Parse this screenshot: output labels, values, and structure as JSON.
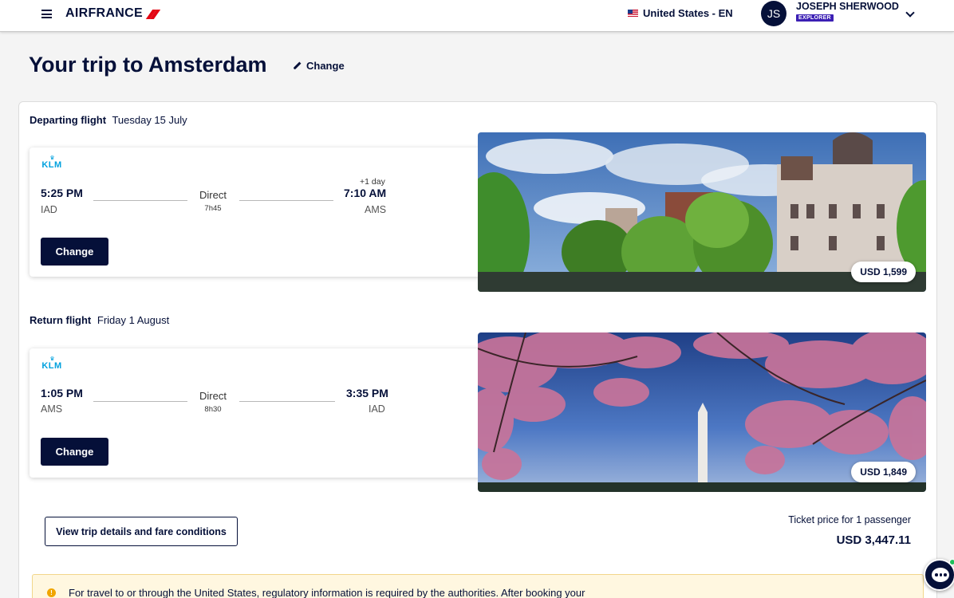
{
  "header": {
    "brand": "AIRFRANCE",
    "locale": "United States - EN",
    "user_initials": "JS",
    "user_name": "JOSEPH SHERWOOD",
    "user_tier": "EXPLORER"
  },
  "page": {
    "title": "Your trip to Amsterdam",
    "change_label": "Change"
  },
  "departing": {
    "label": "Departing flight",
    "date": "Tuesday 15 July",
    "airline": "KLM",
    "dep_time": "5:25 PM",
    "dep_code": "IAD",
    "stops": "Direct",
    "duration": "7h45",
    "day_offset": "+1 day",
    "arr_time": "7:10 AM",
    "arr_code": "AMS",
    "change_label": "Change",
    "price": "USD 1,599"
  },
  "returning": {
    "label": "Return flight",
    "date": "Friday 1 August",
    "airline": "KLM",
    "dep_time": "1:05 PM",
    "dep_code": "AMS",
    "stops": "Direct",
    "duration": "8h30",
    "arr_time": "3:35 PM",
    "arr_code": "IAD",
    "change_label": "Change",
    "price": "USD 1,849"
  },
  "summary": {
    "details_button": "View trip details and fare conditions",
    "ticket_label": "Ticket price for 1 passenger",
    "ticket_total": "USD 3,447.11"
  },
  "notice": {
    "icon": "!",
    "text": "For travel to or through the United States, regulatory information is required by the authorities. After booking your"
  },
  "icons": {
    "menu": "hamburger-icon",
    "flag": "us-flag-icon",
    "chevron": "chevron-down-icon",
    "pencil": "pencil-icon",
    "warning": "warning-icon",
    "chat": "chat-icon"
  },
  "colors": {
    "brand_navy": "#051039",
    "brand_red": "#e30613",
    "klm_blue": "#00a1de",
    "tier_purple": "#3b1fb4",
    "notice_bg": "#fff7e0",
    "notice_icon": "#f0a500"
  }
}
